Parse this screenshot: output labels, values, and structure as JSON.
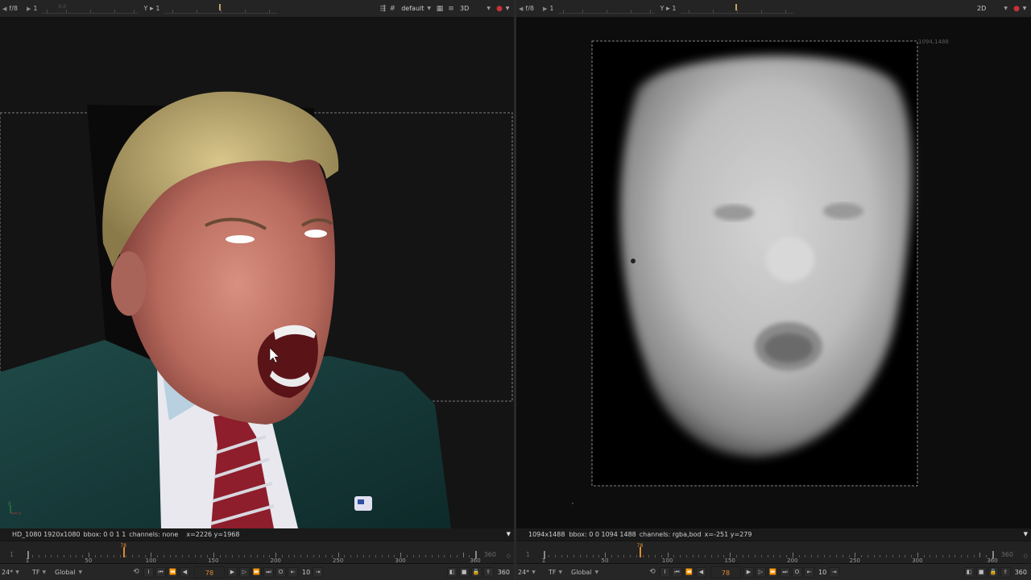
{
  "left": {
    "topbar": {
      "channels": "f/8",
      "frame": "1",
      "y_label": "Y",
      "y_value": "1",
      "lut": "default",
      "view_mode": "3D",
      "ruler_labels": [
        "0.0",
        "1"
      ]
    },
    "viewer": {
      "axis_labels": [
        "y",
        "x"
      ]
    },
    "info": {
      "format": "HD_1080 1920x1080",
      "bbox": "bbox: 0 0 1 1",
      "channels": "channels: none",
      "coords": "x=2226 y=1968"
    },
    "timeline": {
      "start": "1",
      "end": "360",
      "current": "78",
      "labels": [
        "1",
        "50",
        "100",
        "150",
        "200",
        "250",
        "300",
        "360"
      ]
    },
    "controls": {
      "fps": "24*",
      "tf": "TF",
      "range": "Global",
      "frame": "78",
      "step": "10",
      "end": "360"
    }
  },
  "right": {
    "topbar": {
      "channels": "f/8",
      "frame": "1",
      "y_label": "Y",
      "y_value": "1",
      "view_mode": "2D"
    },
    "viewer": {
      "format_label": "1094,1488"
    },
    "info": {
      "format": "1094x1488",
      "bbox": "bbox: 0 0 1094 1488",
      "channels": "channels: rgba,bod",
      "coords": "x=-251 y=279"
    },
    "timeline": {
      "start": "1",
      "end": "360",
      "current": "78",
      "labels": [
        "1",
        "50",
        "100",
        "150",
        "200",
        "250",
        "300",
        "360"
      ]
    },
    "controls": {
      "fps": "24*",
      "tf": "TF",
      "range": "Global",
      "frame": "78",
      "step": "10",
      "end": "360"
    }
  },
  "colors": {
    "accent": "#e08a30",
    "panel": "#151515",
    "toolbar": "#242424",
    "bbox_line": "#aaaaaa",
    "red_button": "#c83232"
  },
  "icons": [
    "wipe-icon",
    "gain-icon",
    "layout-icon",
    "menu-icon",
    "record-icon",
    "play-icon",
    "stop-icon",
    "lock-icon"
  ]
}
